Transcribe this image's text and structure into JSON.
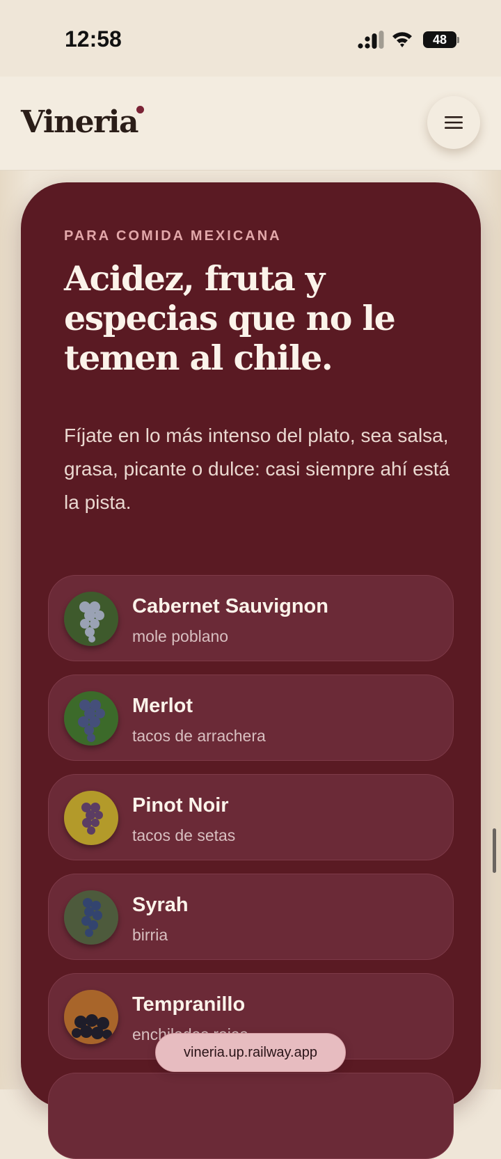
{
  "status_bar": {
    "time": "12:58",
    "battery": "48"
  },
  "header": {
    "brand": "Vineria"
  },
  "hero": {
    "eyebrow": "PARA COMIDA MEXICANA",
    "headline": "Acidez, fruta y especias que no le temen al chile.",
    "lead": "Fíjate en lo más intenso del plato, sea salsa, grasa, picante o dulce: casi siempre ahí está la pista."
  },
  "grapes": [
    {
      "name": "Cabernet Sauvignon",
      "pairing": "mole poblano",
      "thumb_colors": [
        "#3e5a2c",
        "#9aa2b4"
      ]
    },
    {
      "name": "Merlot",
      "pairing": "tacos de arrachera",
      "thumb_colors": [
        "#3c6a2a",
        "#454f7a"
      ]
    },
    {
      "name": "Pinot Noir",
      "pairing": "tacos de setas",
      "thumb_colors": [
        "#b39a2a",
        "#5b3d63"
      ]
    },
    {
      "name": "Syrah",
      "pairing": "birria",
      "thumb_colors": [
        "#4d5a3c",
        "#33446f"
      ]
    },
    {
      "name": "Tempranillo",
      "pairing": "enchiladas rojas",
      "thumb_colors": [
        "#a8652a",
        "#1e1d2a"
      ]
    }
  ],
  "browser": {
    "url": "vineria.up.railway.app"
  },
  "colors": {
    "card": "#5a1a23",
    "item": "#6b2a37",
    "background": "#efe6d8",
    "accent": "#7a2336"
  }
}
